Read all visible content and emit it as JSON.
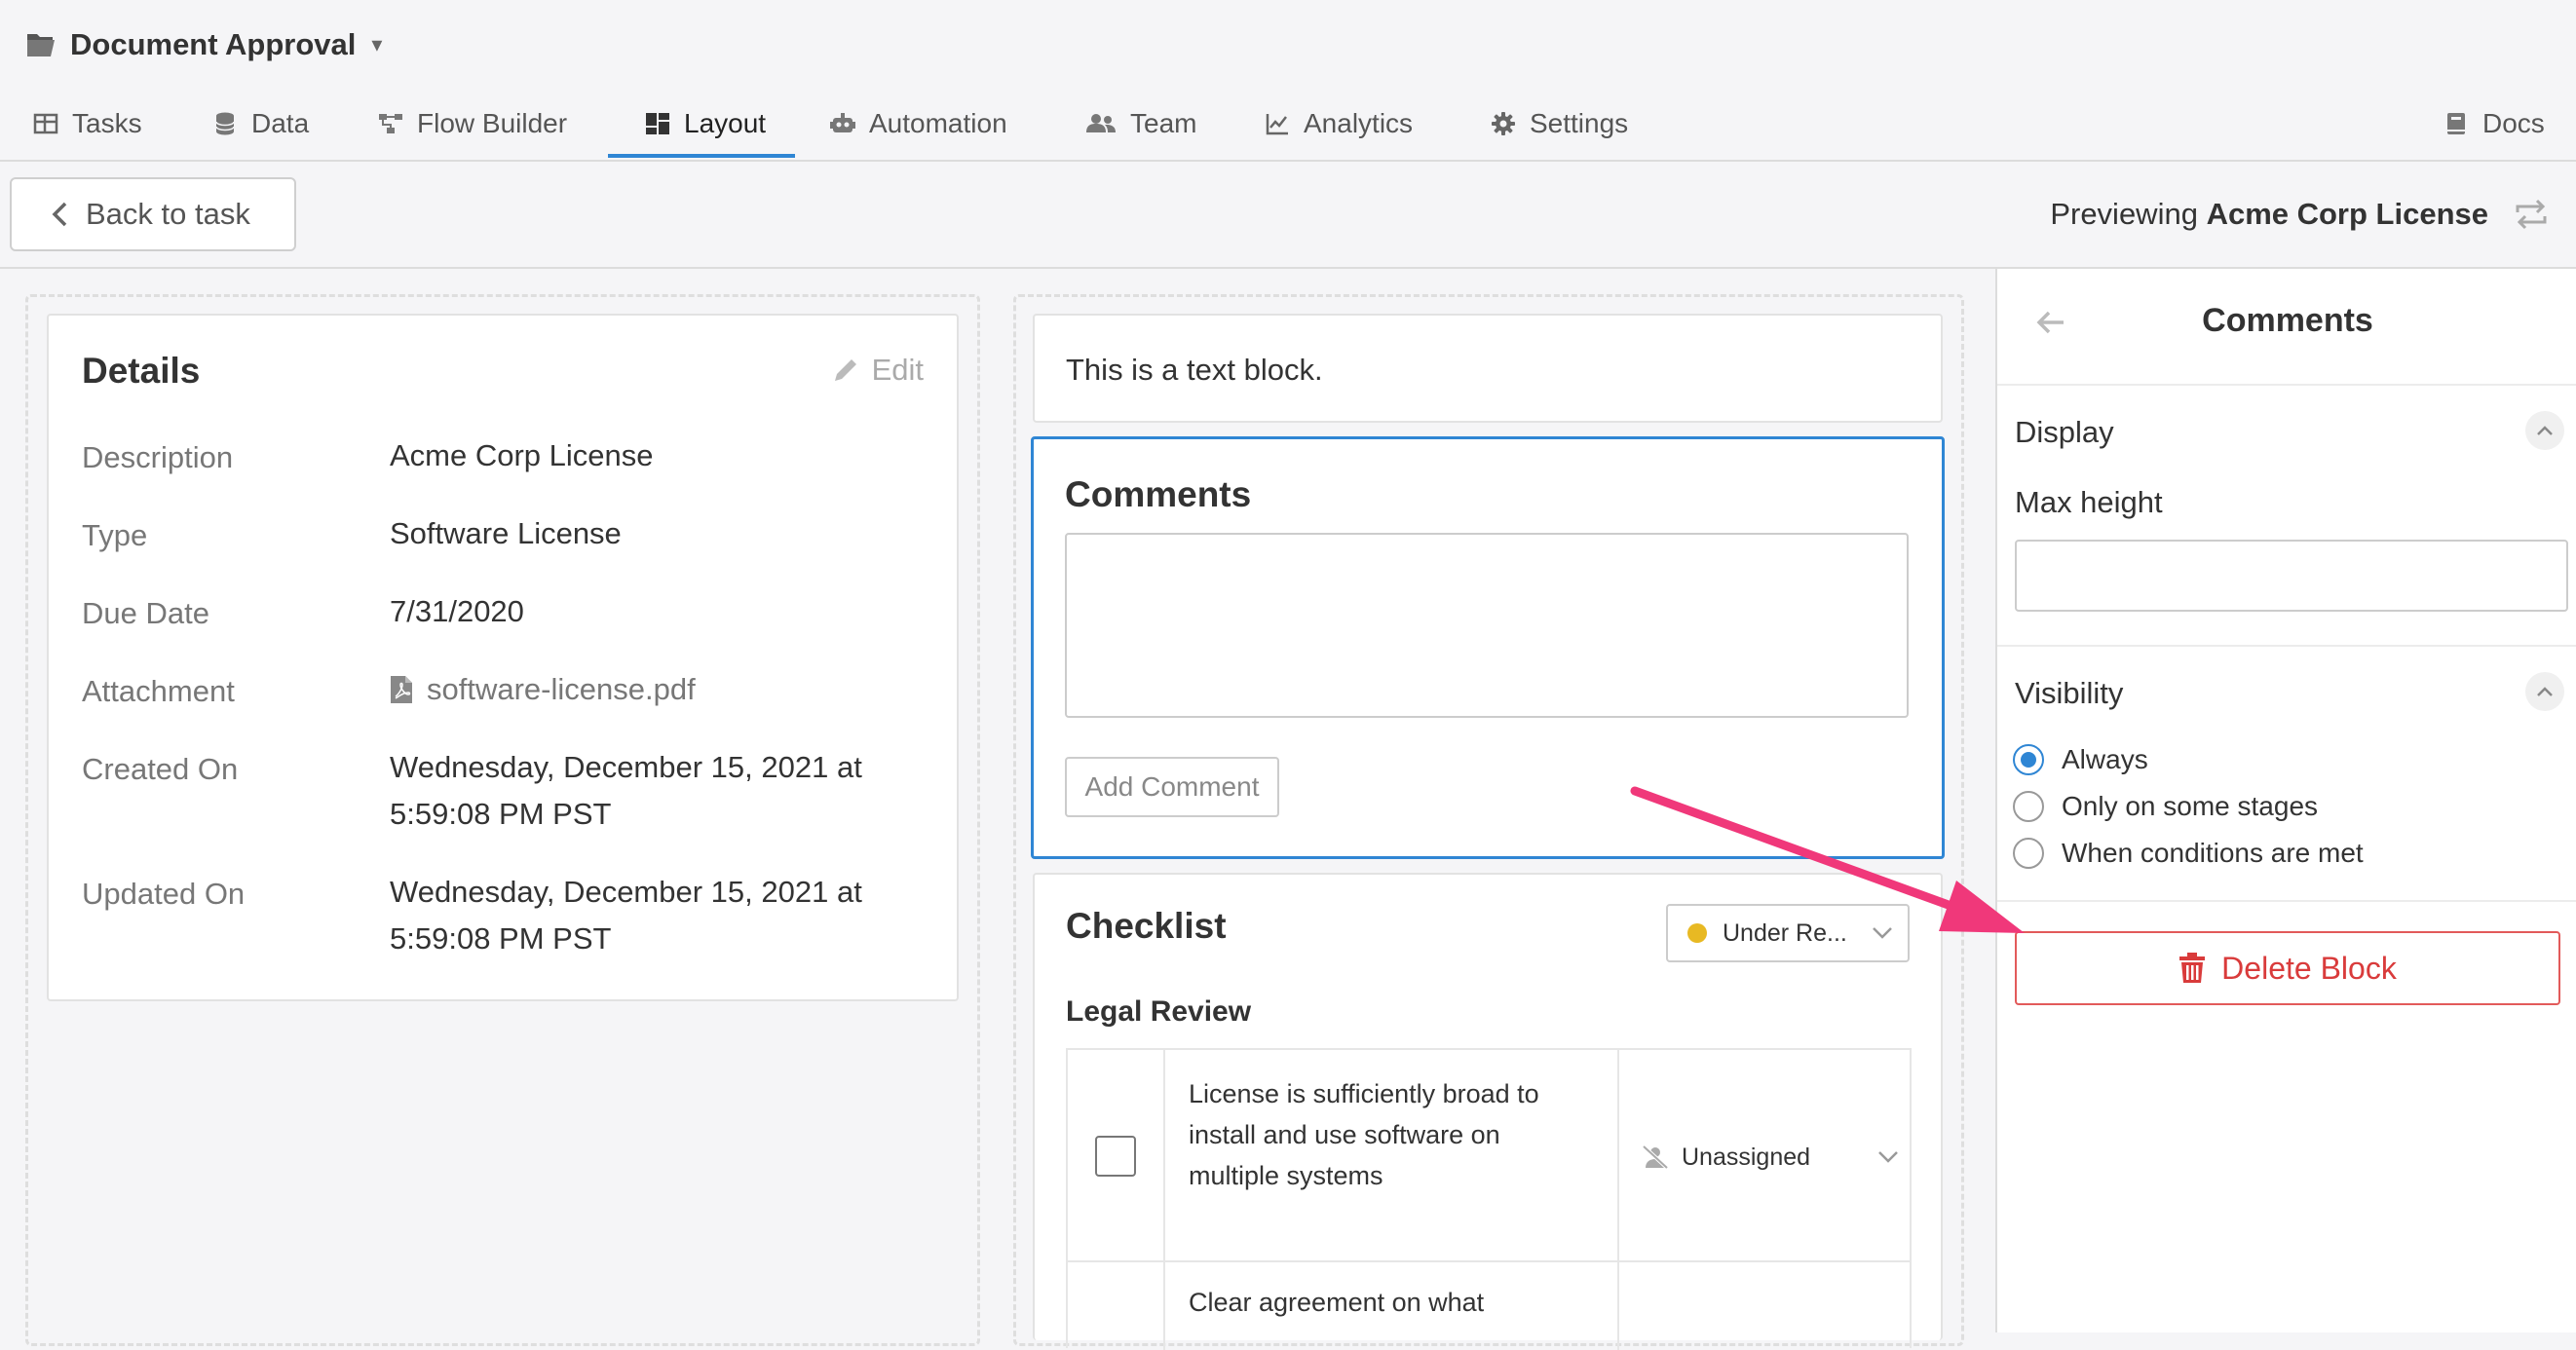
{
  "app": {
    "title": "Document Approval"
  },
  "nav": {
    "tabs": [
      {
        "label": "Tasks",
        "icon": "table-icon"
      },
      {
        "label": "Data",
        "icon": "database-icon"
      },
      {
        "label": "Flow Builder",
        "icon": "flow-icon"
      },
      {
        "label": "Layout",
        "icon": "layout-icon",
        "active": true
      },
      {
        "label": "Automation",
        "icon": "robot-icon"
      },
      {
        "label": "Team",
        "icon": "users-icon"
      },
      {
        "label": "Analytics",
        "icon": "chart-icon"
      },
      {
        "label": "Settings",
        "icon": "gear-icon"
      }
    ],
    "docs": "Docs"
  },
  "toolbar": {
    "back_label": "Back to task",
    "preview_prefix": "Previewing",
    "preview_name": "Acme Corp License"
  },
  "details": {
    "title": "Details",
    "edit_label": "Edit",
    "rows": [
      {
        "label": "Description",
        "value": "Acme Corp License"
      },
      {
        "label": "Type",
        "value": "Software License"
      },
      {
        "label": "Due Date",
        "value": "7/31/2020"
      },
      {
        "label": "Attachment",
        "value": "software-license.pdf"
      },
      {
        "label": "Created On",
        "value": "Wednesday, December 15, 2021 at 5:59:08 PM PST"
      },
      {
        "label": "Updated On",
        "value": "Wednesday, December 15, 2021 at 5:59:08 PM PST"
      }
    ]
  },
  "text_block": {
    "text": "This is a text block."
  },
  "comments_block": {
    "title": "Comments",
    "textarea_value": "",
    "add_label": "Add Comment"
  },
  "checklist": {
    "title": "Checklist",
    "status": "Under Re...",
    "status_color": "#e8b923",
    "section": "Legal Review",
    "items": [
      {
        "text": "License is sufficiently broad to install and use software on multiple systems",
        "assignee": "Unassigned"
      },
      {
        "text": "Clear agreement on what",
        "assignee": ""
      }
    ]
  },
  "panel": {
    "title": "Comments",
    "display_title": "Display",
    "max_height_label": "Max height",
    "max_height_value": "",
    "visibility_title": "Visibility",
    "visibility_options": [
      {
        "label": "Always",
        "checked": true
      },
      {
        "label": "Only on some stages",
        "checked": false
      },
      {
        "label": "When conditions are met",
        "checked": false
      }
    ],
    "delete_label": "Delete Block"
  },
  "colors": {
    "accent": "#2f86d4",
    "danger": "#d93b3b",
    "annotation_arrow": "#f0387a"
  }
}
